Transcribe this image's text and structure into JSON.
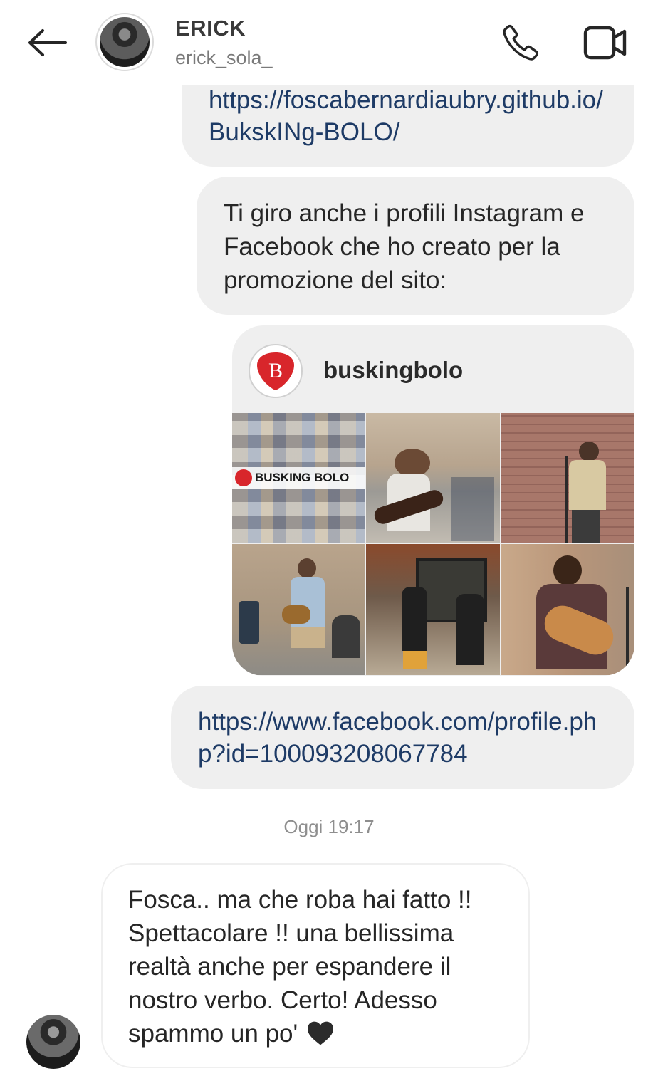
{
  "header": {
    "name": "ERICK",
    "handle": "erick_sola_"
  },
  "icons": {
    "back": "arrow-left-icon",
    "call": "phone-icon",
    "video": "video-camera-icon",
    "heart": "black-heart-icon"
  },
  "messages": {
    "link1": "https://foscabernardiaubry.github.io/BukskINg-BOLO/",
    "msg2": "Ti giro anche i profili Instagram e Facebook che ho creato per la promozione del sito:",
    "card": {
      "account": "buskingbolo",
      "logo_letter": "B",
      "banner_text": "BUSKING BOLO"
    },
    "link2": "https://www.facebook.com/profile.php?id=100093208067784",
    "timestamp": "Oggi 19:17",
    "incoming": "Fosca.. ma che roba hai fatto !! Spettacolare !! una bellissima realtà anche per espandere il nostro verbo. Certo! Adesso spammo un po'"
  },
  "colors": {
    "bubble_bg": "#efefef",
    "link": "#1e3b66",
    "brand_red": "#d8262b"
  }
}
